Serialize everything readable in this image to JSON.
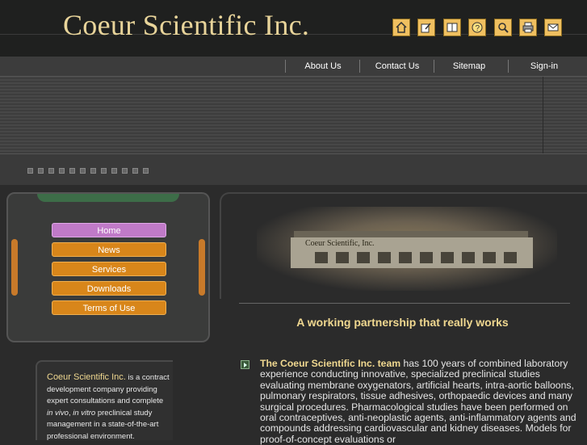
{
  "header": {
    "logo": "Coeur Scientific Inc."
  },
  "toolbar": {
    "icons": [
      "home-icon",
      "edit-icon",
      "book-icon",
      "help-icon",
      "search-icon",
      "print-icon",
      "mail-icon"
    ]
  },
  "nav": {
    "items": [
      {
        "label": "About Us"
      },
      {
        "label": "Contact Us"
      },
      {
        "label": "Sitemap"
      },
      {
        "label": "Sign-in"
      }
    ]
  },
  "menu": {
    "items": [
      {
        "label": "Home",
        "active": true
      },
      {
        "label": "News"
      },
      {
        "label": "Services"
      },
      {
        "label": "Downloads"
      },
      {
        "label": "Terms of Use"
      }
    ]
  },
  "intro": {
    "company": "Coeur Scientific Inc.",
    "text1": " is a contract development company providing expert consultations and complete ",
    "in_vivo": "in vivo",
    "sep": ", ",
    "in_vitro": "in vitro",
    "text2": " preclinical study management in a state-of-the-art professional environment."
  },
  "photo": {
    "sign": "Coeur Scientific, Inc."
  },
  "main": {
    "headline": "A working partnership that really works",
    "team": "The Coeur Scientific Inc. team",
    "body": " has 100 years of combined laboratory experience conducting innovative, specialized preclinical studies evaluating membrane oxygenators, artificial hearts, intra-aortic balloons, pulmonary respirators, tissue adhesives, orthopaedic devices and many surgical procedures.  Pharmacological studies have been performed on oral contraceptives, anti-neoplastic agents, anti-inflammatory agents and compounds addressing cardiovascular and kidney diseases.  Models for proof-of-concept evaluations or"
  },
  "colors": {
    "accent": "#f0d890",
    "menu": "#d8861a",
    "menu_active": "#c07ac8"
  }
}
